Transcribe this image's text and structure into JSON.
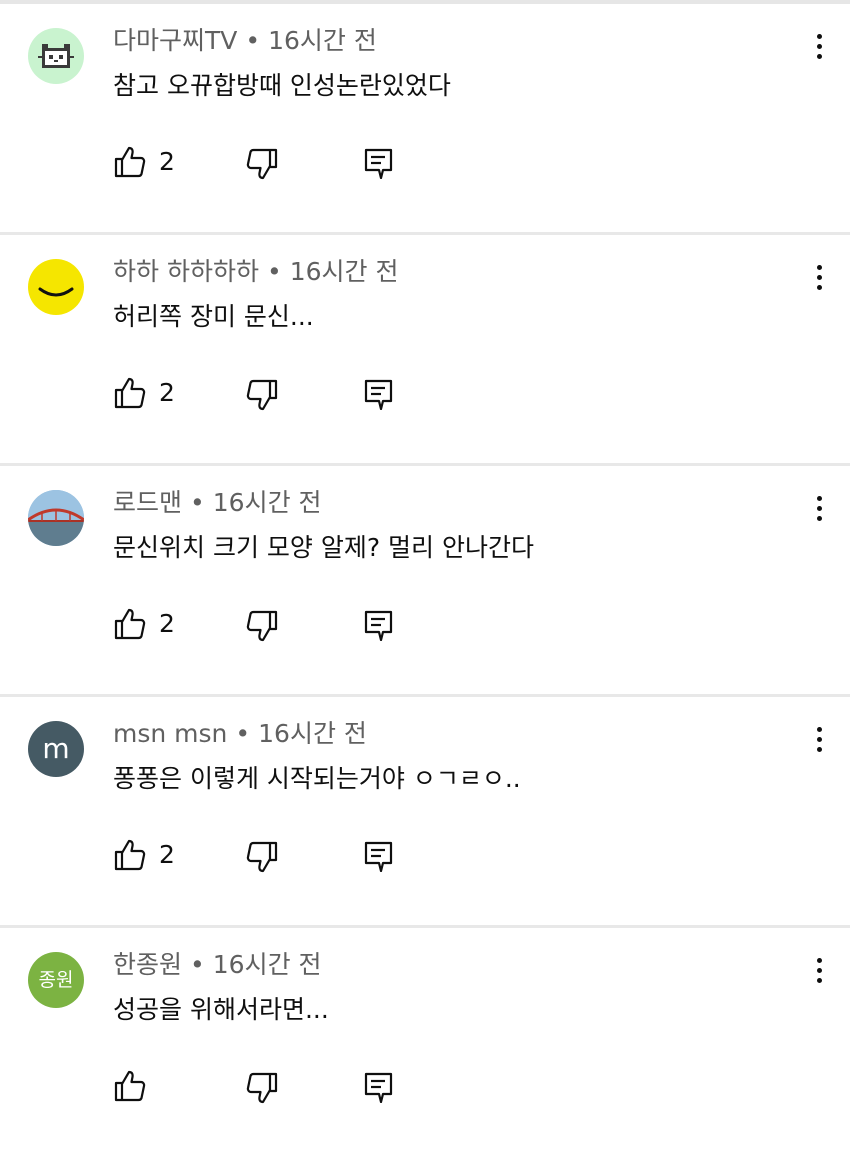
{
  "comments": [
    {
      "author": "다마구찌TV",
      "time": "16시간 전",
      "text": "참고 오뀨합방때 인성논란있었다",
      "likes": "2",
      "avatar": {
        "type": "pixel-cat",
        "bg": "#c9f3cf"
      }
    },
    {
      "author": "하하 하하하하",
      "time": "16시간 전",
      "text": "허리쪽 장미 문신...",
      "likes": "2",
      "avatar": {
        "type": "smile",
        "bg": "#f5e600"
      }
    },
    {
      "author": "로드맨",
      "time": "16시간 전",
      "text": "문신위치 크기 모양 알제? 멀리 안나간다",
      "likes": "2",
      "avatar": {
        "type": "bridge-photo",
        "bg": "#8fb7d8"
      }
    },
    {
      "author": "msn msn",
      "time": "16시간 전",
      "text": "퐁퐁은 이렇게 시작되는거야 ㅇㄱㄹㅇ..",
      "likes": "2",
      "avatar": {
        "type": "letter",
        "letter": "m",
        "bg": "#455a64"
      }
    },
    {
      "author": "한종원",
      "time": "16시간 전",
      "text": "성공을 위해서라면...",
      "likes": "",
      "avatar": {
        "type": "letter",
        "letter": "종원",
        "bg": "#7cb342"
      }
    }
  ],
  "separator": "•",
  "colors": {
    "meta_text": "#606060",
    "text": "#0f0f0f",
    "divider": "#e8e8e8"
  },
  "icons": [
    "like-icon",
    "dislike-icon",
    "reply-icon",
    "more-vert-icon"
  ]
}
